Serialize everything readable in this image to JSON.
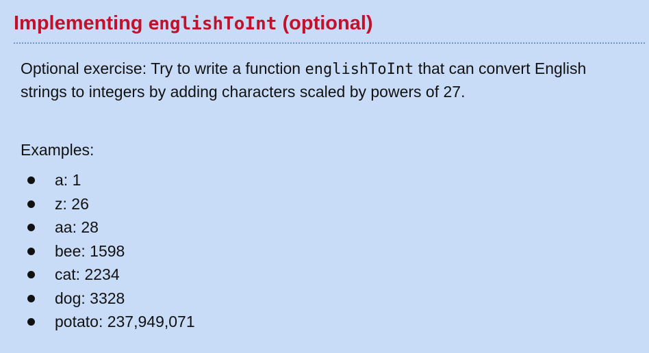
{
  "slide": {
    "title_prefix": "Implementing ",
    "title_code": "englishToInt",
    "title_suffix": " (optional)",
    "body_prefix": "Optional exercise: Try to write a function ",
    "body_code": "englishToInt",
    "body_suffix": " that can convert English strings to integers by adding characters scaled by powers of 27.",
    "examples_label": "Examples:",
    "examples": [
      "a: 1",
      "z: 26",
      "aa: 28",
      "bee: 1598",
      "cat: 2234",
      "dog: 3328",
      "potato: 237,949,071"
    ]
  },
  "colors": {
    "background": "#c8dcf7",
    "title": "#c0122a",
    "divider": "#6f96c8"
  }
}
